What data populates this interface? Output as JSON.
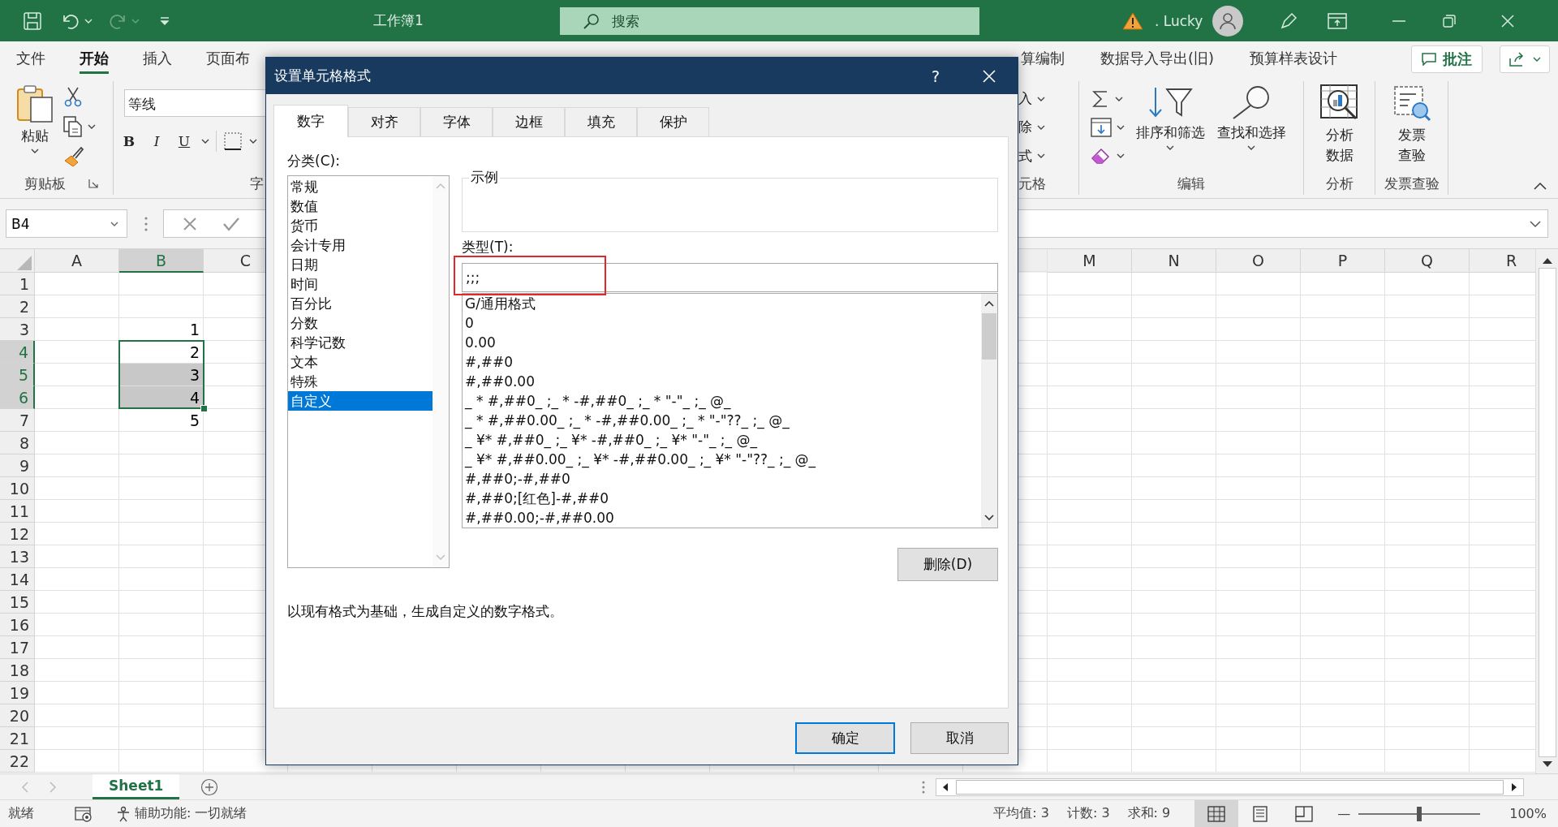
{
  "title_bar": {
    "title": "工作簿1",
    "search": {
      "placeholder": "搜索"
    },
    "user": ". Lucky",
    "redo_disabled": true
  },
  "ribbon": {
    "tabs": [
      {
        "label": "文件",
        "selected": false
      },
      {
        "label": "开始",
        "selected": true
      },
      {
        "label": "插入",
        "selected": false
      },
      {
        "label": "页面布",
        "selected": false
      }
    ],
    "right_tabs": [
      {
        "label": "算编制",
        "selected": false
      },
      {
        "label": "数据导入导出(旧)",
        "selected": false
      },
      {
        "label": "预算样表设计",
        "selected": false
      }
    ],
    "comment_button": "批注",
    "clipboard": {
      "paste": "粘贴",
      "label": "剪贴板"
    },
    "font": {
      "name": "等线",
      "styles": [
        {
          "kind": "bold",
          "label": "B"
        },
        {
          "kind": "italic",
          "label": "I"
        },
        {
          "kind": "underline",
          "label": "U"
        }
      ],
      "label": "字"
    },
    "cells": {
      "items": [
        "入",
        "除",
        "式"
      ],
      "label": "元格"
    },
    "editing": {
      "sort": "排序和筛选",
      "find": "查找和选择",
      "label": "编辑"
    },
    "analysis": {
      "button": "分析数据",
      "label": "分析"
    },
    "invoice": {
      "button": "发票查验",
      "label": "发票查验"
    }
  },
  "formula_bar": {
    "name_box": "B4"
  },
  "sheet": {
    "columns": [
      {
        "label": "A",
        "selected": false
      },
      {
        "label": "B",
        "selected": true
      },
      {
        "label": "C",
        "selected": false
      },
      {
        "label": "M",
        "selected": false
      },
      {
        "label": "N",
        "selected": false
      },
      {
        "label": "O",
        "selected": false
      },
      {
        "label": "P",
        "selected": false
      },
      {
        "label": "Q",
        "selected": false
      },
      {
        "label": "R",
        "selected": false
      }
    ],
    "rows": [
      {
        "label": "1",
        "selected": false
      },
      {
        "label": "2",
        "selected": false
      },
      {
        "label": "3",
        "selected": false,
        "cell_b": {
          "value": "1",
          "highlighted": false
        }
      },
      {
        "label": "4",
        "selected": true,
        "cell_b": {
          "value": "2",
          "highlighted": false
        }
      },
      {
        "label": "5",
        "selected": true,
        "cell_b": {
          "value": "3",
          "highlighted": true
        }
      },
      {
        "label": "6",
        "selected": true,
        "cell_b": {
          "value": "4",
          "highlighted": true
        }
      },
      {
        "label": "7",
        "selected": false,
        "cell_b": {
          "value": "5",
          "highlighted": false
        }
      },
      {
        "label": "8",
        "selected": false
      },
      {
        "label": "9",
        "selected": false
      },
      {
        "label": "10",
        "selected": false
      },
      {
        "label": "11",
        "selected": false
      },
      {
        "label": "12",
        "selected": false
      },
      {
        "label": "13",
        "selected": false
      },
      {
        "label": "14",
        "selected": false
      },
      {
        "label": "15",
        "selected": false
      },
      {
        "label": "16",
        "selected": false
      },
      {
        "label": "17",
        "selected": false
      },
      {
        "label": "18",
        "selected": false
      },
      {
        "label": "19",
        "selected": false
      },
      {
        "label": "20",
        "selected": false
      },
      {
        "label": "21",
        "selected": false
      },
      {
        "label": "22",
        "selected": false
      }
    ]
  },
  "sheet_tabs": [
    {
      "label": "Sheet1",
      "selected": true
    }
  ],
  "status_bar": {
    "ready": "就绪",
    "accessibility": "辅助功能: 一切就绪",
    "average": "平均值: 3",
    "count": "计数: 3",
    "sum": "求和: 9",
    "views": [
      {
        "kind": "normal",
        "selected": true
      },
      {
        "kind": "page_layout",
        "selected": false
      },
      {
        "kind": "page_break",
        "selected": false
      }
    ],
    "zoom": {
      "minus": "—",
      "level": 0.5,
      "reading": "100%"
    }
  },
  "dialog": {
    "title": "设置单元格格式",
    "help": "?",
    "tabs": [
      {
        "label": "数字",
        "selected": true
      },
      {
        "label": "对齐",
        "selected": false
      },
      {
        "label": "字体",
        "selected": false
      },
      {
        "label": "边框",
        "selected": false
      },
      {
        "label": "填充",
        "selected": false
      },
      {
        "label": "保护",
        "selected": false
      }
    ],
    "category_label": "分类(C):",
    "categories": [
      {
        "label": "常规",
        "selected": false
      },
      {
        "label": "数值",
        "selected": false
      },
      {
        "label": "货币",
        "selected": false
      },
      {
        "label": "会计专用",
        "selected": false
      },
      {
        "label": "日期",
        "selected": false
      },
      {
        "label": "时间",
        "selected": false
      },
      {
        "label": "百分比",
        "selected": false
      },
      {
        "label": "分数",
        "selected": false
      },
      {
        "label": "科学记数",
        "selected": false
      },
      {
        "label": "文本",
        "selected": false
      },
      {
        "label": "特殊",
        "selected": false
      },
      {
        "label": "自定义",
        "selected": true
      }
    ],
    "sample_label": "示例",
    "type_label": "类型(T):",
    "type_value": ";;;",
    "type_annotated": true,
    "formats": [
      "G/通用格式",
      "0",
      "0.00",
      "#,##0",
      "#,##0.00",
      "_ * #,##0_ ;_ * -#,##0_ ;_ * \"-\"_ ;_ @_",
      "_ * #,##0.00_ ;_ * -#,##0.00_ ;_ * \"-\"??_ ;_ @_",
      "_ ¥* #,##0_ ;_ ¥* -#,##0_ ;_ ¥* \"-\"_ ;_ @_",
      "_ ¥* #,##0.00_ ;_ ¥* -#,##0.00_ ;_ ¥* \"-\"??_ ;_ @_",
      "#,##0;-#,##0",
      "#,##0;[红色]-#,##0",
      "#,##0.00;-#,##0.00"
    ],
    "delete_button": "删除(D)",
    "description": "以现有格式为基础，生成自定义的数字格式。",
    "ok_button": {
      "label": "确定",
      "focused": true
    },
    "cancel_button": "取消"
  }
}
